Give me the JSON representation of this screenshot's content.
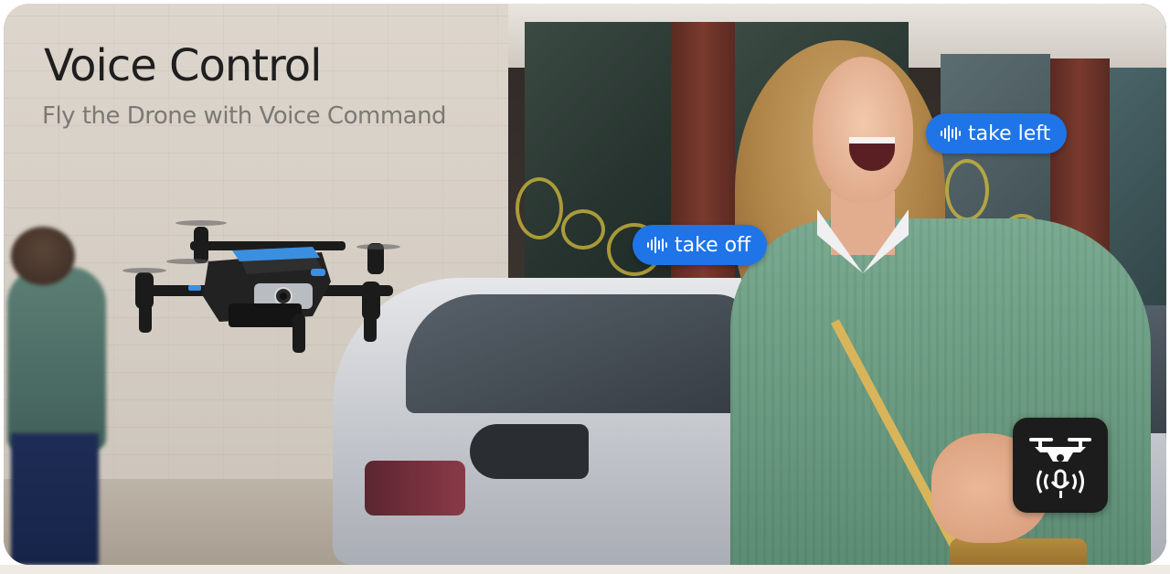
{
  "headline": {
    "title": "Voice Control",
    "subtitle": "Fly the Drone with Voice Command"
  },
  "voice_commands": [
    {
      "label": "take off",
      "icon": "sound-wave-icon"
    },
    {
      "label": "take left",
      "icon": "sound-wave-icon"
    }
  ],
  "badge": {
    "icon": "voice-drone-icon"
  },
  "colors": {
    "pill_blue": "#1f74e8",
    "title": "#1f1f1f",
    "subtitle": "#7c7874",
    "badge_bg": "#1c1c1c"
  }
}
